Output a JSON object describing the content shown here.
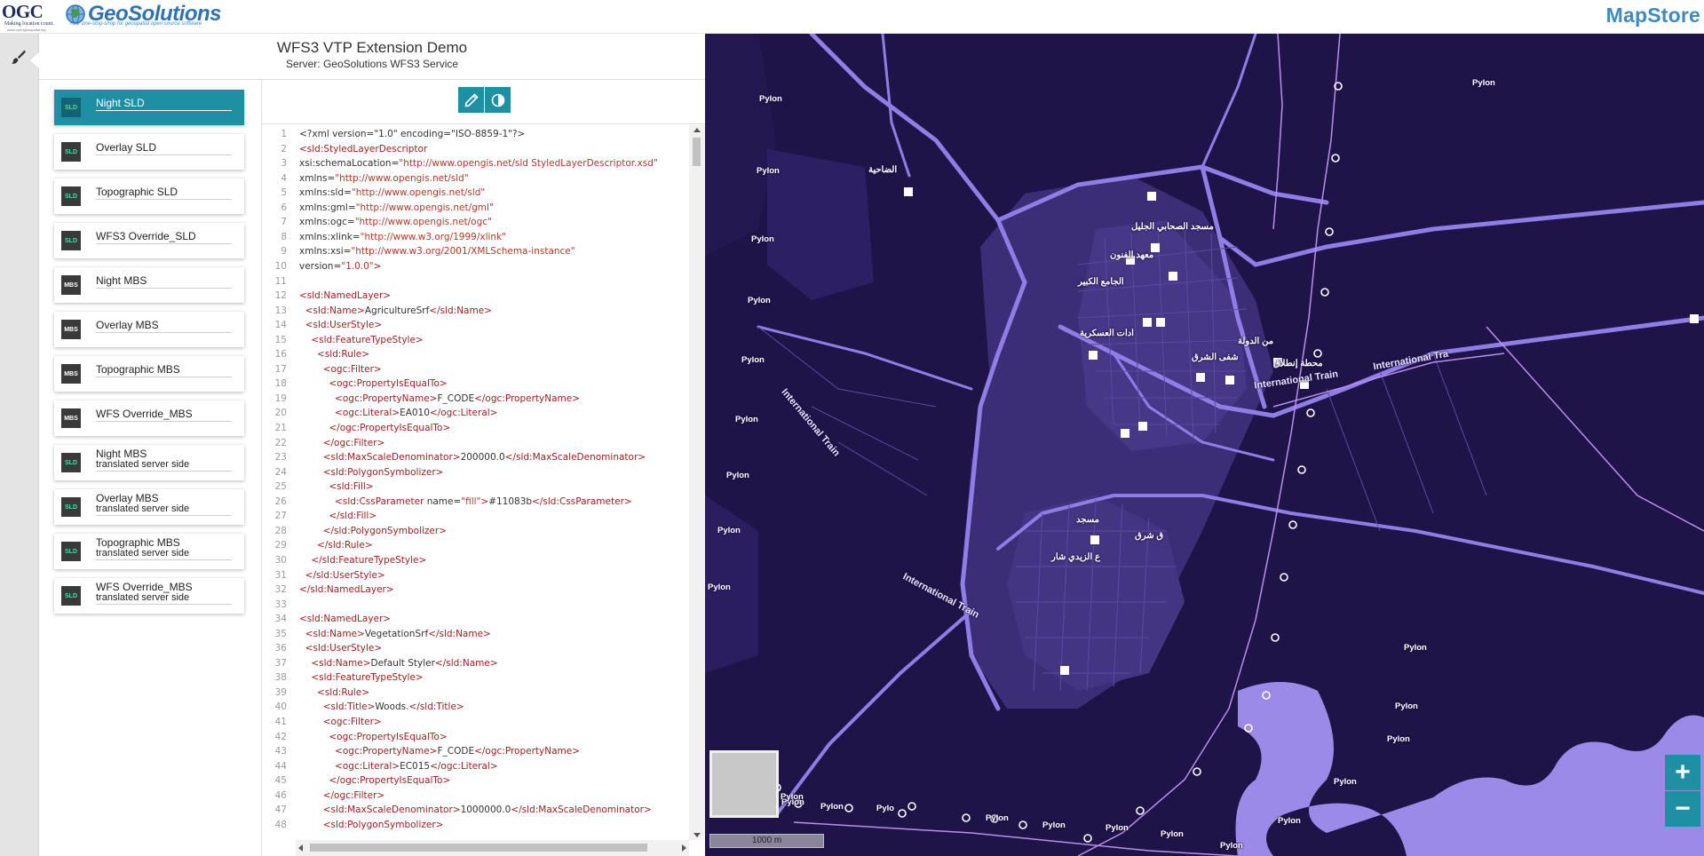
{
  "header": {
    "ogc_logo": {
      "text": "OGC",
      "sub": "Making location count.",
      "url_text": "www.opengeospatial.org"
    },
    "geosolutions_logo": {
      "text": "GeoSolutions",
      "tagline": "Your one-stop-shop for geospatial open source software"
    },
    "mapstore_logo": {
      "text": "MapStore"
    }
  },
  "left_bar": {
    "icon": "paintbrush-icon"
  },
  "app": {
    "title": "WFS3 VTP Extension Demo",
    "server": "Server: GeoSolutions WFS3 Service"
  },
  "styles": [
    {
      "type": "SLD",
      "title": "Night SLD",
      "sub": "",
      "selected": true
    },
    {
      "type": "SLD",
      "title": "Overlay SLD",
      "sub": ""
    },
    {
      "type": "SLD",
      "title": "Topographic SLD",
      "sub": ""
    },
    {
      "type": "SLD",
      "title": "WFS3 Override_SLD",
      "sub": ""
    },
    {
      "type": "MBS",
      "title": "Night MBS",
      "sub": ""
    },
    {
      "type": "MBS",
      "title": "Overlay MBS",
      "sub": ""
    },
    {
      "type": "MBS",
      "title": "Topographic MBS",
      "sub": ""
    },
    {
      "type": "MBS",
      "title": "WFS Override_MBS",
      "sub": ""
    },
    {
      "type": "SLD",
      "title": "Night MBS",
      "sub": "translated server side"
    },
    {
      "type": "SLD",
      "title": "Overlay MBS",
      "sub": "translated server side"
    },
    {
      "type": "SLD",
      "title": "Topographic MBS",
      "sub": "translated server side"
    },
    {
      "type": "SLD",
      "title": "WFS Override_MBS",
      "sub": "translated server side"
    }
  ],
  "editor": {
    "toolbar": [
      {
        "icon": "pencil-icon"
      },
      {
        "icon": "contrast-icon"
      }
    ],
    "lines": [
      {
        "n": "1",
        "segs": [
          [
            "a",
            "<?xml version=\"1.0\" encoding=\"ISO-8859-1\"?>"
          ]
        ]
      },
      {
        "n": "2",
        "segs": [
          [
            "t",
            "<sld:StyledLayerDescriptor"
          ]
        ]
      },
      {
        "n": "3",
        "segs": [
          [
            "a",
            "xsi:schemaLocation="
          ],
          [
            "s",
            "\"http://www.opengis.net/sld StyledLayerDescriptor.xsd\""
          ]
        ]
      },
      {
        "n": "4",
        "segs": [
          [
            "a",
            "xmlns="
          ],
          [
            "s",
            "\"http://www.opengis.net/sld\""
          ]
        ]
      },
      {
        "n": "5",
        "segs": [
          [
            "a",
            "xmlns:sld="
          ],
          [
            "s",
            "\"http://www.opengis.net/sld\""
          ]
        ]
      },
      {
        "n": "6",
        "segs": [
          [
            "a",
            "xmlns:gml="
          ],
          [
            "s",
            "\"http://www.opengis.net/gml\""
          ]
        ]
      },
      {
        "n": "7",
        "segs": [
          [
            "a",
            "xmlns:ogc="
          ],
          [
            "s",
            "\"http://www.opengis.net/ogc\""
          ]
        ]
      },
      {
        "n": "8",
        "segs": [
          [
            "a",
            "xmlns:xlink="
          ],
          [
            "s",
            "\"http://www.w3.org/1999/xlink\""
          ]
        ]
      },
      {
        "n": "9",
        "segs": [
          [
            "a",
            "xmlns:xsi="
          ],
          [
            "s",
            "\"http://www.w3.org/2001/XMLSchema-instance\""
          ]
        ]
      },
      {
        "n": "10",
        "segs": [
          [
            "a",
            "version="
          ],
          [
            "s",
            "\"1.0.0\""
          ],
          [
            "t",
            ">"
          ]
        ]
      },
      {
        "n": "11",
        "segs": []
      },
      {
        "n": "12",
        "segs": [
          [
            "t",
            "<sld:NamedLayer>"
          ]
        ]
      },
      {
        "n": "13",
        "segs": [
          [
            "t",
            "  <sld:Name>"
          ],
          [
            "a",
            "AgricultureSrf"
          ],
          [
            "t",
            "</sld:Name>"
          ]
        ]
      },
      {
        "n": "14",
        "segs": [
          [
            "t",
            "  <sld:UserStyle>"
          ]
        ]
      },
      {
        "n": "15",
        "segs": [
          [
            "t",
            "    <sld:FeatureTypeStyle>"
          ]
        ]
      },
      {
        "n": "16",
        "segs": [
          [
            "t",
            "      <sld:Rule>"
          ]
        ]
      },
      {
        "n": "17",
        "segs": [
          [
            "t",
            "        <ogc:Filter>"
          ]
        ]
      },
      {
        "n": "18",
        "segs": [
          [
            "t",
            "          <ogc:PropertyIsEqualTo>"
          ]
        ]
      },
      {
        "n": "19",
        "segs": [
          [
            "t",
            "            <ogc:PropertyName>"
          ],
          [
            "a",
            "F_CODE"
          ],
          [
            "t",
            "</ogc:PropertyName>"
          ]
        ]
      },
      {
        "n": "20",
        "segs": [
          [
            "t",
            "            <ogc:Literal>"
          ],
          [
            "a",
            "EA010"
          ],
          [
            "t",
            "</ogc:Literal>"
          ]
        ]
      },
      {
        "n": "21",
        "segs": [
          [
            "t",
            "          </ogc:PropertyIsEqualTo>"
          ]
        ]
      },
      {
        "n": "22",
        "segs": [
          [
            "t",
            "        </ogc:Filter>"
          ]
        ]
      },
      {
        "n": "23",
        "segs": [
          [
            "t",
            "        <sld:MaxScaleDenominator>"
          ],
          [
            "a",
            "200000.0"
          ],
          [
            "t",
            "</sld:MaxScaleDenominator>"
          ]
        ]
      },
      {
        "n": "24",
        "segs": [
          [
            "t",
            "        <sld:PolygonSymbolizer>"
          ]
        ]
      },
      {
        "n": "25",
        "segs": [
          [
            "t",
            "          <sld:Fill>"
          ]
        ]
      },
      {
        "n": "26",
        "segs": [
          [
            "t",
            "            <sld:CssParameter "
          ],
          [
            "a",
            "name="
          ],
          [
            "s",
            "\"fill\""
          ],
          [
            "t",
            ">"
          ],
          [
            "a",
            "#11083b"
          ],
          [
            "t",
            "</sld:CssParameter>"
          ]
        ]
      },
      {
        "n": "27",
        "segs": [
          [
            "t",
            "          </sld:Fill>"
          ]
        ]
      },
      {
        "n": "28",
        "segs": [
          [
            "t",
            "        </sld:PolygonSymbolizer>"
          ]
        ]
      },
      {
        "n": "29",
        "segs": [
          [
            "t",
            "      </sld:Rule>"
          ]
        ]
      },
      {
        "n": "30",
        "segs": [
          [
            "t",
            "    </sld:FeatureTypeStyle>"
          ]
        ]
      },
      {
        "n": "31",
        "segs": [
          [
            "t",
            "  </sld:UserStyle>"
          ]
        ]
      },
      {
        "n": "32",
        "segs": [
          [
            "t",
            "</sld:NamedLayer>"
          ]
        ]
      },
      {
        "n": "33",
        "segs": []
      },
      {
        "n": "34",
        "segs": [
          [
            "t",
            "<sld:NamedLayer>"
          ]
        ]
      },
      {
        "n": "35",
        "segs": [
          [
            "t",
            "  <sld:Name>"
          ],
          [
            "a",
            "VegetationSrf"
          ],
          [
            "t",
            "</sld:Name>"
          ]
        ]
      },
      {
        "n": "36",
        "segs": [
          [
            "t",
            "  <sld:UserStyle>"
          ]
        ]
      },
      {
        "n": "37",
        "segs": [
          [
            "t",
            "    <sld:Name>"
          ],
          [
            "a",
            "Default Styler"
          ],
          [
            "t",
            "</sld:Name>"
          ]
        ]
      },
      {
        "n": "38",
        "segs": [
          [
            "t",
            "    <sld:FeatureTypeStyle>"
          ]
        ]
      },
      {
        "n": "39",
        "segs": [
          [
            "t",
            "      <sld:Rule>"
          ]
        ]
      },
      {
        "n": "40",
        "segs": [
          [
            "t",
            "        <sld:Title>"
          ],
          [
            "a",
            "Woods."
          ],
          [
            "t",
            "</sld:Title>"
          ]
        ]
      },
      {
        "n": "41",
        "segs": [
          [
            "t",
            "        <ogc:Filter>"
          ]
        ]
      },
      {
        "n": "42",
        "segs": [
          [
            "t",
            "          <ogc:PropertyIsEqualTo>"
          ]
        ]
      },
      {
        "n": "43",
        "segs": [
          [
            "t",
            "            <ogc:PropertyName>"
          ],
          [
            "a",
            "F_CODE"
          ],
          [
            "t",
            "</ogc:PropertyName>"
          ]
        ]
      },
      {
        "n": "44",
        "segs": [
          [
            "t",
            "            <ogc:Literal>"
          ],
          [
            "a",
            "EC015"
          ],
          [
            "t",
            "</ogc:Literal>"
          ]
        ]
      },
      {
        "n": "45",
        "segs": [
          [
            "t",
            "          </ogc:PropertyIsEqualTo>"
          ]
        ]
      },
      {
        "n": "46",
        "segs": [
          [
            "t",
            "        </ogc:Filter>"
          ]
        ]
      },
      {
        "n": "47",
        "segs": [
          [
            "t",
            "        <sld:MaxScaleDenominator>"
          ],
          [
            "a",
            "1000000.0"
          ],
          [
            "t",
            "</sld:MaxScaleDenominator>"
          ]
        ]
      },
      {
        "n": "48",
        "segs": [
          [
            "t",
            "        <sld:PolygonSymbolizer>"
          ]
        ]
      }
    ]
  },
  "map": {
    "background": "#1f1447",
    "pylon_label": "Pylon",
    "partial_pylon_label": "Pylo",
    "train_label": "International Train",
    "partial_train_label": "International Tra",
    "arabic_labels": [
      "الضاحية",
      "مسجد الصحابي الجليل",
      "معهد الفنون",
      "الجامع الكبير",
      "شفى الشرق",
      "من الدولة",
      "محطة إنطلاق",
      "ادات العسكرية",
      "ع الزيدي شار",
      "ق شرق",
      "مسجد"
    ],
    "zoom_in_label": "+",
    "zoom_out_label": "−",
    "scale_label": "1000 m"
  },
  "colors": {
    "accent": "#1f8fa4",
    "badge": "#3a3a3a",
    "sld_badge_text": "#5ad7a3",
    "xml_tag": "#a32020",
    "xml_string": "#b5382a",
    "map_road": "#8f7ee6",
    "map_block": "#43337f"
  }
}
